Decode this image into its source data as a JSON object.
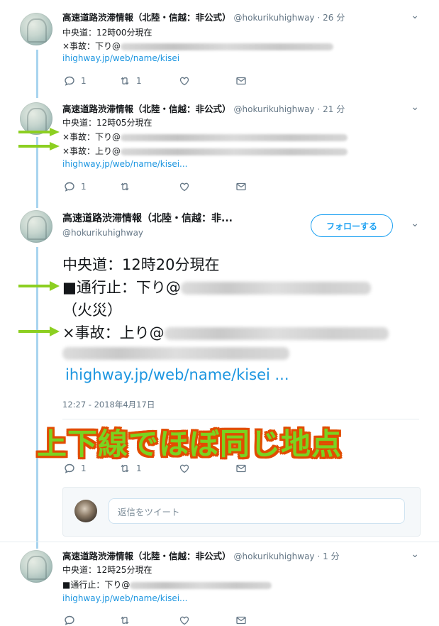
{
  "colors": {
    "accent": "#1da1f2",
    "link": "#1b95e0",
    "muted": "#657786",
    "thread_line": "#a8d4ef",
    "overlay_fill": "#7ad320",
    "overlay_stroke": "#e24c00",
    "arrow": "#8ccf21"
  },
  "tweets": [
    {
      "name": "高速道路渋滞情報（北陸・信越：非公式）",
      "handle": "@hokurikuhighway",
      "time": "· 26 分",
      "lines": [
        "中央道：12時00分現在",
        "×事故：下り@"
      ],
      "link": "ihighway.jp/web/name/kisei",
      "replies": "1",
      "retweets": "1",
      "likes": ""
    },
    {
      "name": "高速道路渋滞情報（北陸・信越：非公式）",
      "handle": "@hokurikuhighway",
      "time": "· 21 分",
      "lines": [
        "中央道：12時05分現在",
        "×事故：下り@",
        "×事故：上り@"
      ],
      "link": "ihighway.jp/web/name/kisei...",
      "replies": "1",
      "retweets": "",
      "likes": ""
    },
    {
      "name": "高速道路渋滞情報（北陸・信越：非...",
      "handle": "@hokurikuhighway",
      "follow_label": "フォローする",
      "lines": [
        "中央道：12時20分現在",
        "■通行止：下り@",
        "（火災）",
        "×事故：上り@"
      ],
      "link": "ihighway.jp/web/name/kisei ...",
      "timestamp": "12:27 - 2018年4月17日",
      "replies": "1",
      "retweets": "1",
      "likes": ""
    },
    {
      "name": "高速道路渋滞情報（北陸・信越：非公式）",
      "handle": "@hokurikuhighway",
      "time": "· 1 分",
      "lines": [
        "中央道：12時25分現在",
        "■通行止：下り@"
      ],
      "link": "ihighway.jp/web/name/kisei..."
    }
  ],
  "reply": {
    "placeholder": "返信をツイート"
  },
  "overlay_text": "上下線でほぼ同じ地点",
  "icons": [
    "reply-icon",
    "retweet-icon",
    "like-icon",
    "dm-icon",
    "chevron-down-icon",
    "arrow-icon"
  ]
}
